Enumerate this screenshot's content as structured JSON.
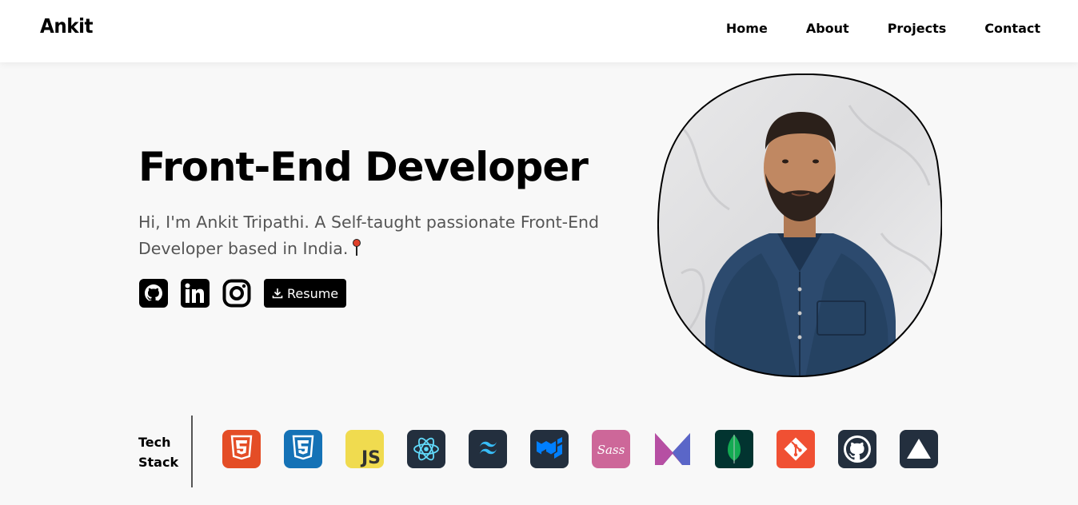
{
  "header": {
    "logo": "Ankit",
    "nav": [
      {
        "label": "Home"
      },
      {
        "label": "About"
      },
      {
        "label": "Projects"
      },
      {
        "label": "Contact"
      }
    ]
  },
  "hero": {
    "title": "Front-End Developer",
    "intro": "Hi, I'm Ankit Tripathi. A Self-taught passionate Front-End Developer based in India.",
    "pin_icon": "round-pushpin-icon",
    "social": [
      "github-icon",
      "linkedin-icon",
      "instagram-icon"
    ],
    "resume_button": "Resume",
    "resume_icon": "download-icon",
    "portrait": "profile-photo"
  },
  "tech_stack": {
    "label_line1": "Tech",
    "label_line2": "Stack",
    "icons": [
      "html5-icon",
      "css3-icon",
      "javascript-icon",
      "react-icon",
      "tailwind-icon",
      "material-ui-icon",
      "sass-icon",
      "redux-icon",
      "mongodb-icon",
      "git-icon",
      "github-icon",
      "vercel-icon"
    ],
    "js_text": "JS",
    "sass_text": "Sass"
  },
  "colors": {
    "background": "#f8f8f8",
    "header_bg": "#ffffff",
    "text": "#000000",
    "muted": "#555555",
    "html5": "#e44d26",
    "css3": "#1572b6",
    "javascript": "#f0db4f",
    "react": "#61dafb",
    "dark_tile": "#232f3e",
    "sass": "#cd6799",
    "mongodb": "#023430",
    "mongodb_leaf": "#13aa52",
    "git": "#f05033"
  }
}
